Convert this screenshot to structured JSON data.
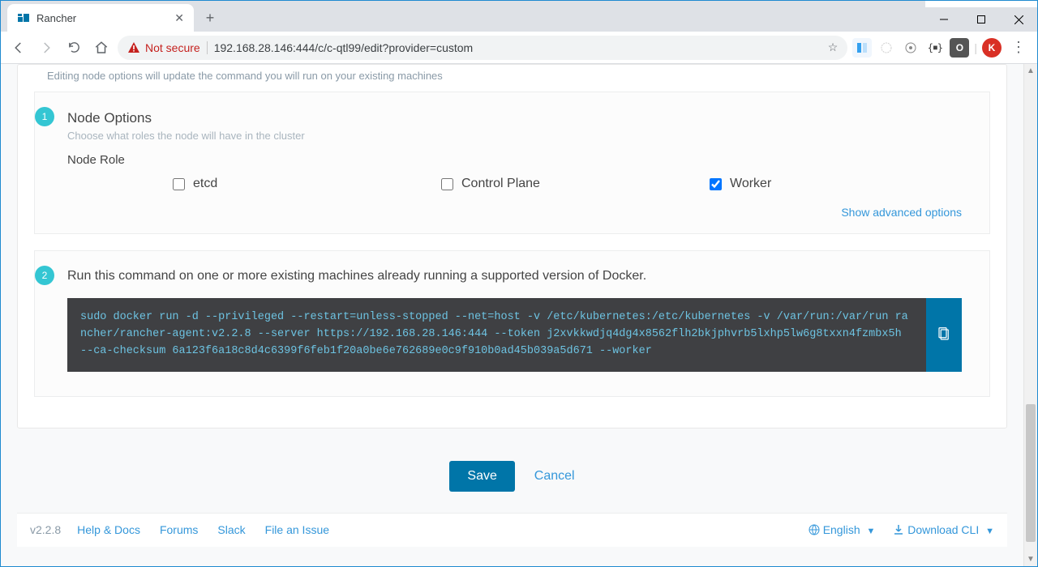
{
  "browser": {
    "tab_title": "Rancher",
    "not_secure": "Not secure",
    "url": "192.168.28.146:444/c/c-qtl99/edit?provider=custom"
  },
  "header": {
    "subtext": "Editing node options will update the command you will run on your existing machines"
  },
  "step1": {
    "badge": "1",
    "title": "Node Options",
    "subtitle": "Choose what roles the node will have in the cluster",
    "role_label": "Node Role",
    "roles": {
      "etcd": {
        "label": "etcd",
        "checked": false
      },
      "control_plane": {
        "label": "Control Plane",
        "checked": false
      },
      "worker": {
        "label": "Worker",
        "checked": true
      }
    },
    "advanced_link": "Show advanced options"
  },
  "step2": {
    "badge": "2",
    "title": "Run this command on one or more existing machines already running a supported version of Docker.",
    "command": "sudo docker run -d --privileged --restart=unless-stopped --net=host -v /etc/kubernetes:/etc/kubernetes -v /var/run:/var/run rancher/rancher-agent:v2.2.8 --server https://192.168.28.146:444 --token j2xvkkwdjq4dg4x8562flh2bkjphvrb5lxhp5lw6g8txxn4fzmbx5h --ca-checksum 6a123f6a18c8d4c6399f6feb1f20a0be6e762689e0c9f910b0ad45b039a5d671 --worker"
  },
  "actions": {
    "save": "Save",
    "cancel": "Cancel"
  },
  "footer": {
    "version": "v2.2.8",
    "help": "Help & Docs",
    "forums": "Forums",
    "slack": "Slack",
    "issue": "File an Issue",
    "language": "English",
    "download": "Download CLI"
  }
}
